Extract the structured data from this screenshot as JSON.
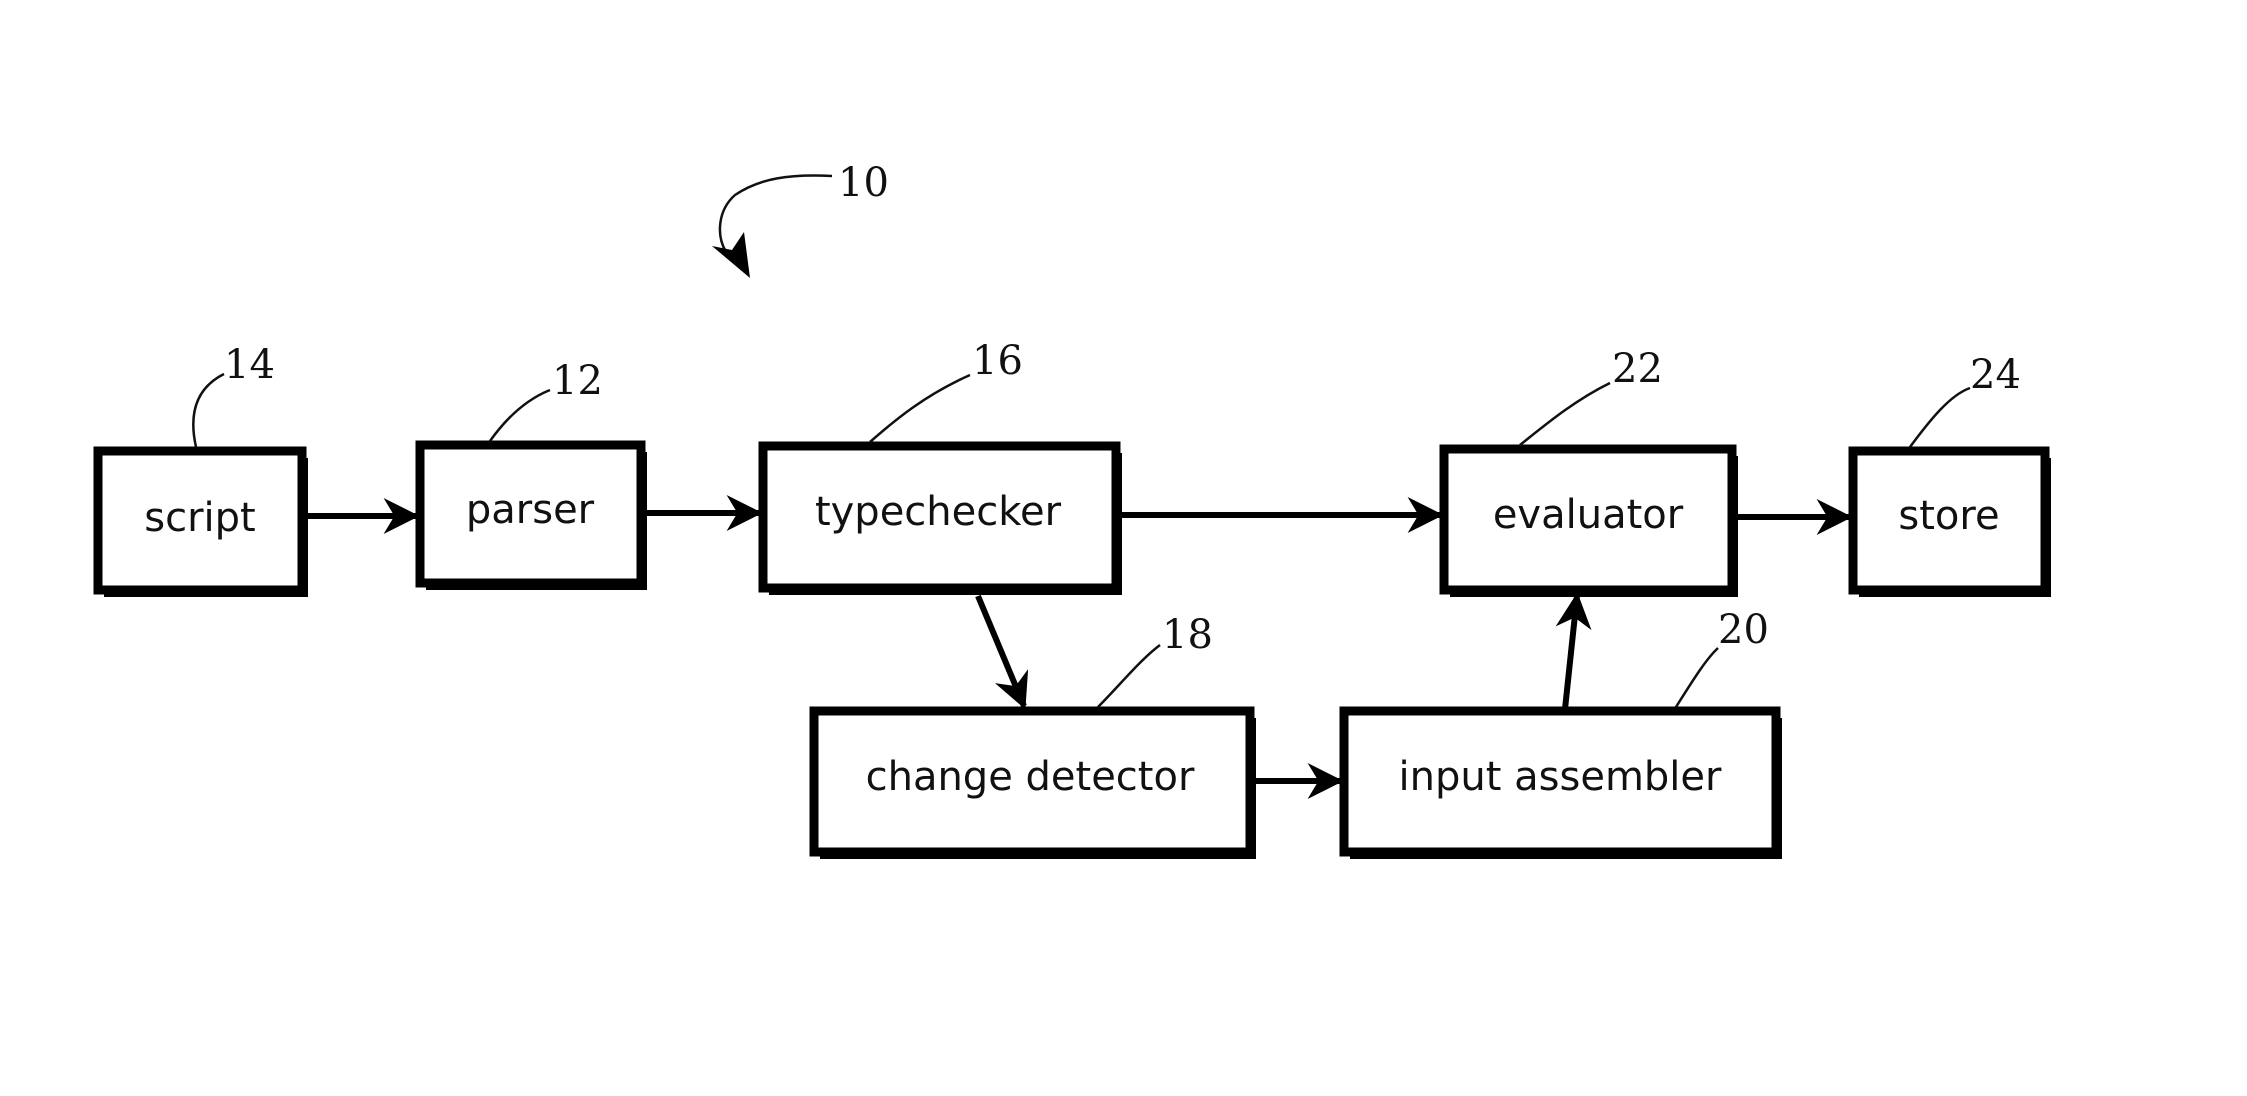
{
  "figure": {
    "reference": "10",
    "nodes": [
      {
        "id": "script",
        "label": "script",
        "ref": "14"
      },
      {
        "id": "parser",
        "label": "parser",
        "ref": "12"
      },
      {
        "id": "typechecker",
        "label": "typechecker",
        "ref": "16"
      },
      {
        "id": "evaluator",
        "label": "evaluator",
        "ref": "22"
      },
      {
        "id": "store",
        "label": "store",
        "ref": "24"
      },
      {
        "id": "change-detector",
        "label": "change detector",
        "ref": "18"
      },
      {
        "id": "input-assembler",
        "label": "input assembler",
        "ref": "20"
      }
    ],
    "edges": [
      {
        "from": "script",
        "to": "parser"
      },
      {
        "from": "parser",
        "to": "typechecker"
      },
      {
        "from": "typechecker",
        "to": "evaluator"
      },
      {
        "from": "evaluator",
        "to": "store"
      },
      {
        "from": "typechecker",
        "to": "change-detector"
      },
      {
        "from": "change-detector",
        "to": "input-assembler"
      },
      {
        "from": "input-assembler",
        "to": "evaluator"
      }
    ]
  }
}
